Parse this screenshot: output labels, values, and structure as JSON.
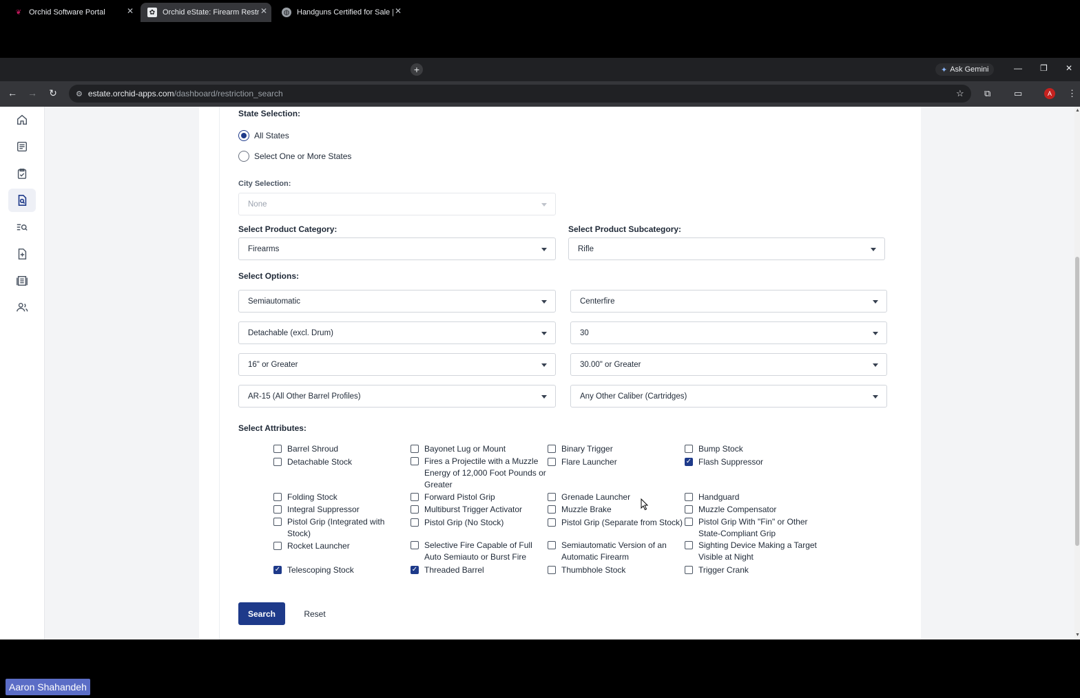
{
  "browser": {
    "tabs": [
      {
        "label": "Orchid Software Portal",
        "active": false
      },
      {
        "label": "Orchid eState: Firearm Restrictio",
        "active": true
      },
      {
        "label": "Handguns Certified for Sale | St",
        "active": false
      }
    ],
    "gemini_label": "Ask Gemini",
    "url_host": "estate.orchid-apps.com",
    "url_path": "/dashboard/restriction_search",
    "profile_initial": "A"
  },
  "form": {
    "state_label": "State Selection:",
    "state_options": [
      {
        "label": "All States",
        "selected": true
      },
      {
        "label": "Select One or More States",
        "selected": false
      }
    ],
    "city_label": "City Selection:",
    "city_value": "None",
    "category_label": "Select Product Category:",
    "category_value": "Firearms",
    "subcategory_label": "Select Product Subcategory:",
    "subcategory_value": "Rifle",
    "options_label": "Select Options:",
    "options": [
      "Semiautomatic",
      "Centerfire",
      "Detachable (excl. Drum)",
      "30",
      "16\" or Greater",
      "30.00\" or Greater",
      "AR-15 (All Other Barrel Profiles)",
      "Any Other Caliber (Cartridges)"
    ],
    "attributes_label": "Select Attributes:",
    "attributes": [
      {
        "label": "Barrel Shroud",
        "checked": false
      },
      {
        "label": "Bayonet Lug or Mount",
        "checked": false
      },
      {
        "label": "Binary Trigger",
        "checked": false
      },
      {
        "label": "Bump Stock",
        "checked": false
      },
      {
        "label": "Detachable Stock",
        "checked": false
      },
      {
        "label": "Fires a Projectile with a Muzzle Energy of 12,000 Foot Pounds or Greater",
        "checked": false
      },
      {
        "label": "Flare Launcher",
        "checked": false
      },
      {
        "label": "Flash Suppressor",
        "checked": true
      },
      {
        "label": "Folding Stock",
        "checked": false
      },
      {
        "label": "Forward Pistol Grip",
        "checked": false
      },
      {
        "label": "Grenade Launcher",
        "checked": false
      },
      {
        "label": "Handguard",
        "checked": false
      },
      {
        "label": "Integral Suppressor",
        "checked": false
      },
      {
        "label": "Multiburst Trigger Activator",
        "checked": false
      },
      {
        "label": "Muzzle Brake",
        "checked": false
      },
      {
        "label": "Muzzle Compensator",
        "checked": false
      },
      {
        "label": "Pistol Grip (Integrated with Stock)",
        "checked": false
      },
      {
        "label": "Pistol Grip (No Stock)",
        "checked": false
      },
      {
        "label": "Pistol Grip (Separate from Stock)",
        "checked": false
      },
      {
        "label": "Pistol Grip With \"Fin\" or Other State-Compliant Grip",
        "checked": false
      },
      {
        "label": "Rocket Launcher",
        "checked": false
      },
      {
        "label": "Selective Fire Capable of Full Auto Semiauto or Burst Fire",
        "checked": false
      },
      {
        "label": "Semiautomatic Version of an Automatic Firearm",
        "checked": false
      },
      {
        "label": "Sighting Device Making a Target Visible at Night",
        "checked": false
      },
      {
        "label": "Telescoping Stock",
        "checked": true
      },
      {
        "label": "Threaded Barrel",
        "checked": true
      },
      {
        "label": "Thumbhole Stock",
        "checked": false
      },
      {
        "label": "Trigger Crank",
        "checked": false
      }
    ],
    "search_label": "Search",
    "reset_label": "Reset"
  },
  "sidebar_icons": [
    "home-icon",
    "list-icon",
    "clipboard-check-icon",
    "document-search-icon",
    "search-list-icon",
    "document-add-icon",
    "report-icon",
    "users-icon"
  ],
  "overlay_name": "Aaron Shahandeh",
  "colors": {
    "accent": "#1e3a8a",
    "chrome": "#202124"
  }
}
